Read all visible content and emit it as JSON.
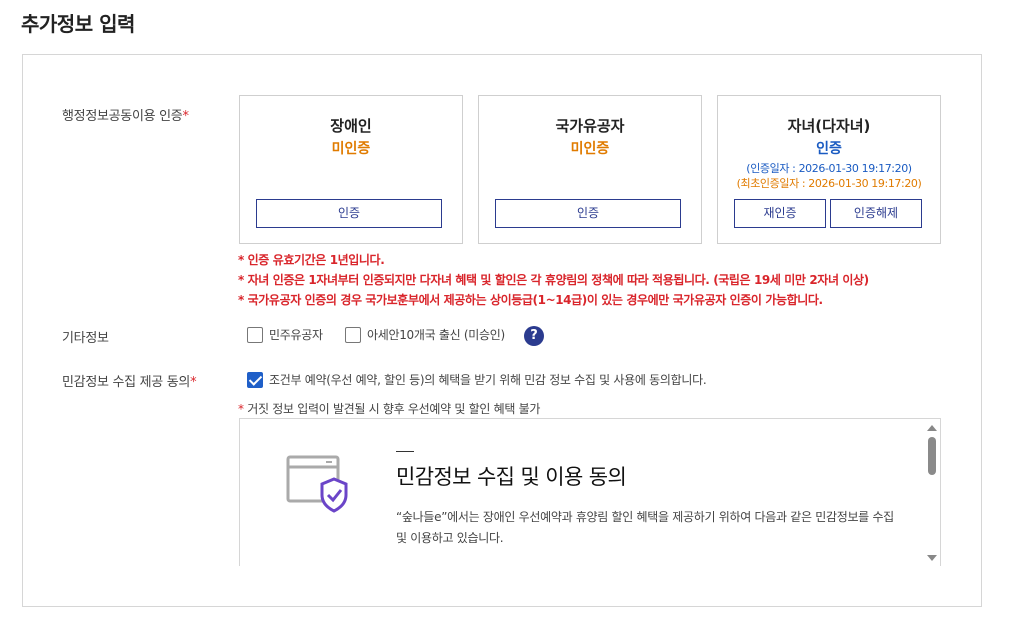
{
  "page": {
    "title": "추가정보 입력"
  },
  "auth": {
    "label": "행정정보공동이용 인증",
    "required_mark": "*",
    "cards": [
      {
        "title": "장애인",
        "status": "미인증",
        "buttons": [
          "인증"
        ]
      },
      {
        "title": "국가유공자",
        "status": "미인증",
        "buttons": [
          "인증"
        ]
      },
      {
        "title": "자녀(다자녀)",
        "status": "인증",
        "auth_date": "(인증일자 : 2026-01-30 19:17:20)",
        "first_auth_date": "(최초인증일자 : 2026-01-30 19:17:20)",
        "buttons": [
          "재인증",
          "인증해제"
        ]
      }
    ],
    "notes": [
      "* 인증 유효기간은 1년입니다.",
      "* 자녀 인증은 1자녀부터 인증되지만 다자녀 혜택 및 할인은 각 휴양림의 정책에 따라 적용됩니다. (국립은 19세 미만 2자녀 이상)",
      "* 국가유공자 인증의 경우 국가보훈부에서 제공하는 상이등급(1~14급)이 있는 경우에만 국가유공자 인증이 가능합니다."
    ]
  },
  "etc": {
    "label": "기타정보",
    "options": [
      {
        "label": "민주유공자",
        "checked": false
      },
      {
        "label": "아세안10개국 출신 (미승인)",
        "checked": false
      }
    ],
    "help": "?"
  },
  "consent": {
    "label": "민감정보 수집 제공 동의",
    "required_mark": "*",
    "checkbox_label": "조건부 예약(우선 예약, 할인 등)의 혜택을 받기 위해 민감 정보 수집 및 사용에 동의합니다.",
    "checked": true,
    "warning_star": "*",
    "warning": " 거짓 정보 입력이 발견될 시 향후 우선예약 및 할인 혜택 불가",
    "terms_title": "민감정보 수집 및 이용 동의",
    "terms_body": "“숲나들e”에서는 장애인 우선예약과 휴양림 할인 혜택을 제공하기 위하여 다음과 같은 민감정보를 수집 및 이용하고 있습니다."
  },
  "colors": {
    "accent": "#2b3b8f",
    "pending": "#e07b00",
    "done": "#1a5bc2",
    "required": "#d9252b"
  }
}
